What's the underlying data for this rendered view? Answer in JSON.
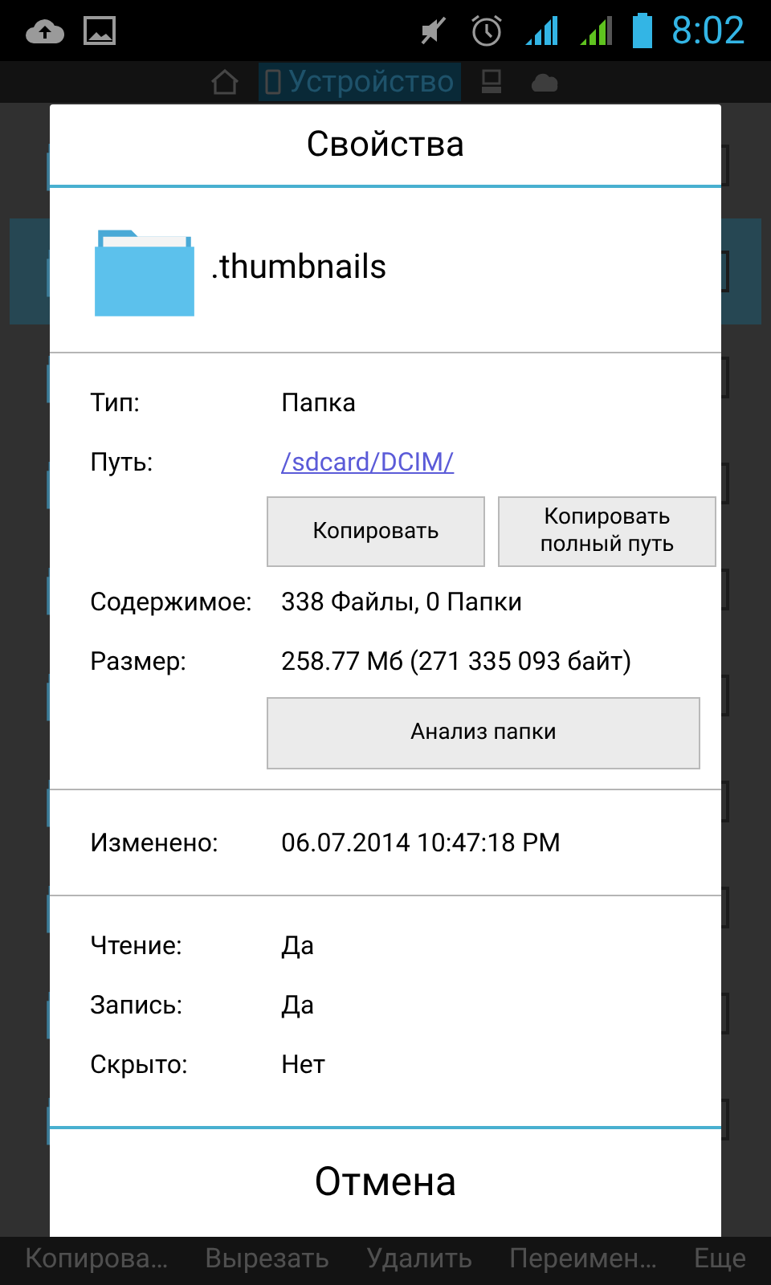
{
  "status_bar": {
    "time": "8:02"
  },
  "tabs": [
    {
      "kind": "home",
      "selected": false
    },
    {
      "kind": "device",
      "label": "Устройство",
      "selected": true
    },
    {
      "kind": "computer",
      "selected": false
    },
    {
      "kind": "cloud",
      "selected": false
    }
  ],
  "file_list": [
    {
      "selected": false
    },
    {
      "selected": true
    },
    {
      "selected": false
    },
    {
      "selected": false
    },
    {
      "selected": false
    },
    {
      "selected": false
    },
    {
      "selected": false
    },
    {
      "selected": false
    },
    {
      "selected": false
    },
    {
      "selected": false
    }
  ],
  "dialog": {
    "title": "Свойства",
    "file_name": ".thumbnails",
    "sections": [
      {
        "rows": [
          {
            "kind": "field",
            "label": "Тип:",
            "value": "Папка"
          },
          {
            "kind": "link",
            "label": "Путь:",
            "value": "/sdcard/DCIM/"
          },
          {
            "kind": "buttons",
            "buttons": [
              "Копировать",
              "Копировать полный путь"
            ]
          },
          {
            "kind": "field",
            "label": "Содержимое:",
            "value": "338 Файлы, 0 Папки"
          },
          {
            "kind": "field",
            "label": "Размер:",
            "value": "258.77 Мб (271 335 093 байт)"
          },
          {
            "kind": "button",
            "button": "Анализ папки"
          }
        ]
      },
      {
        "rows": [
          {
            "kind": "field",
            "label": "Изменено:",
            "value": "06.07.2014 10:47:18 PM"
          }
        ]
      },
      {
        "rows": [
          {
            "kind": "field",
            "label": "Чтение:",
            "value": "Да"
          },
          {
            "kind": "field",
            "label": "Запись:",
            "value": "Да"
          },
          {
            "kind": "field",
            "label": "Скрыто:",
            "value": "Нет"
          }
        ]
      }
    ],
    "cancel": "Отмена"
  },
  "bottom_actions": [
    "Копирова…",
    "Вырезать",
    "Удалить",
    "Переимен…",
    "Еще"
  ]
}
